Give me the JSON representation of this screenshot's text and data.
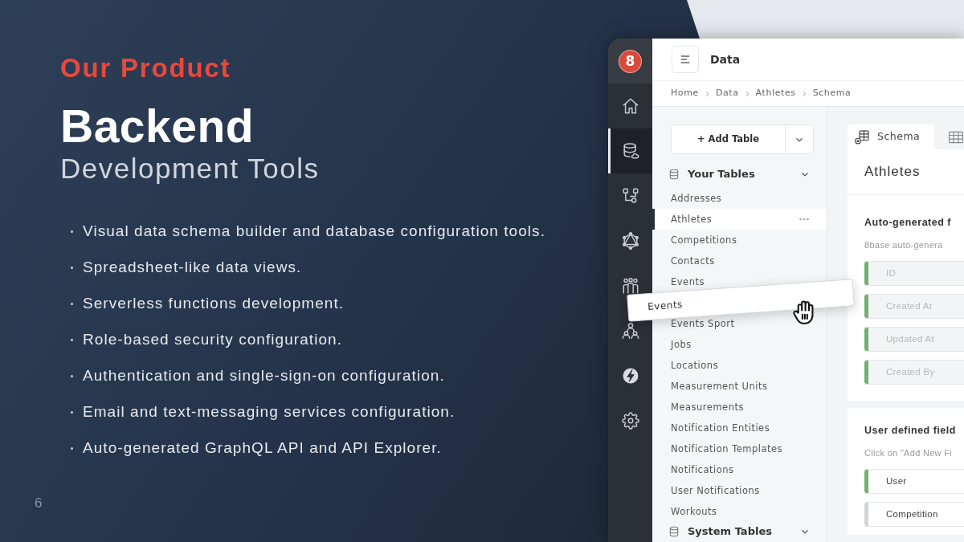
{
  "slide": {
    "eyebrow": "Our Product",
    "title": "Backend",
    "subtitle": "Development Tools",
    "bullets": [
      "Visual data schema builder and database configuration tools.",
      "Spreadsheet-like data views.",
      "Serverless functions development.",
      "Role-based security configuration.",
      "Authentication and single-sign-on configuration.",
      "Email and text-messaging services configuration.",
      "Auto-generated GraphQL API and API Explorer."
    ],
    "page_number": "6"
  },
  "app": {
    "logo": "8",
    "rail": [
      {
        "kind": "home",
        "selected": false
      },
      {
        "kind": "database",
        "selected": true
      },
      {
        "kind": "flow",
        "selected": false
      },
      {
        "kind": "graph",
        "selected": false
      },
      {
        "kind": "people",
        "selected": false
      },
      {
        "kind": "team",
        "selected": false
      },
      {
        "kind": "function",
        "selected": false
      },
      {
        "kind": "settings",
        "selected": false
      }
    ],
    "header": {
      "title": "Data"
    },
    "breadcrumb": [
      "Home",
      "Data",
      "Athletes",
      "Schema"
    ],
    "add_table_button": "+ Add Table",
    "table_groups": [
      {
        "title": "Your Tables",
        "items": [
          {
            "kind": "table",
            "label": "Addresses",
            "selected": false
          },
          {
            "kind": "table",
            "label": "Athletes",
            "selected": true
          },
          {
            "kind": "table",
            "label": "Competitions",
            "selected": false
          },
          {
            "kind": "table",
            "label": "Contacts",
            "selected": false
          },
          {
            "kind": "table",
            "label": "Events",
            "selected": false
          },
          {
            "kind": "dragged",
            "label": "Events",
            "selected": false
          },
          {
            "kind": "table",
            "label": "Events Sport",
            "selected": false
          },
          {
            "kind": "table",
            "label": "Jobs",
            "selected": false
          },
          {
            "kind": "table",
            "label": "Locations",
            "selected": false
          },
          {
            "kind": "table",
            "label": "Measurement Units",
            "selected": false
          },
          {
            "kind": "table",
            "label": "Measurements",
            "selected": false
          },
          {
            "kind": "table",
            "label": "Notification Entities",
            "selected": false
          },
          {
            "kind": "table",
            "label": "Notification Templates",
            "selected": false
          },
          {
            "kind": "table",
            "label": "Notifications",
            "selected": false
          },
          {
            "kind": "table",
            "label": "User Notifications",
            "selected": false
          },
          {
            "kind": "table",
            "label": "Workouts",
            "selected": false
          }
        ]
      },
      {
        "title": "System Tables"
      }
    ],
    "tabs": [
      {
        "kind": "schema",
        "label": "Schema",
        "selected": true
      },
      {
        "kind": "grid",
        "selected": false
      }
    ],
    "schema_cards": [
      {
        "heading": "Athletes",
        "title": "Auto-generated f",
        "note": "8base auto-genera",
        "fields": [
          {
            "label": "ID",
            "color": "#72b072",
            "disabled": true
          },
          {
            "label": "Created At",
            "color": "#72b072",
            "disabled": true
          },
          {
            "label": "Updated At",
            "color": "#72b072",
            "disabled": true
          },
          {
            "label": "Created By",
            "color": "#72b072",
            "disabled": true
          }
        ]
      },
      {
        "title": "User defined field",
        "note": "Click on \"Add New Fi",
        "fields": [
          {
            "label": "User",
            "color": "#72b072",
            "disabled": false
          },
          {
            "label": "Competition",
            "color": "#d0d3d7",
            "disabled": false
          }
        ]
      }
    ]
  }
}
